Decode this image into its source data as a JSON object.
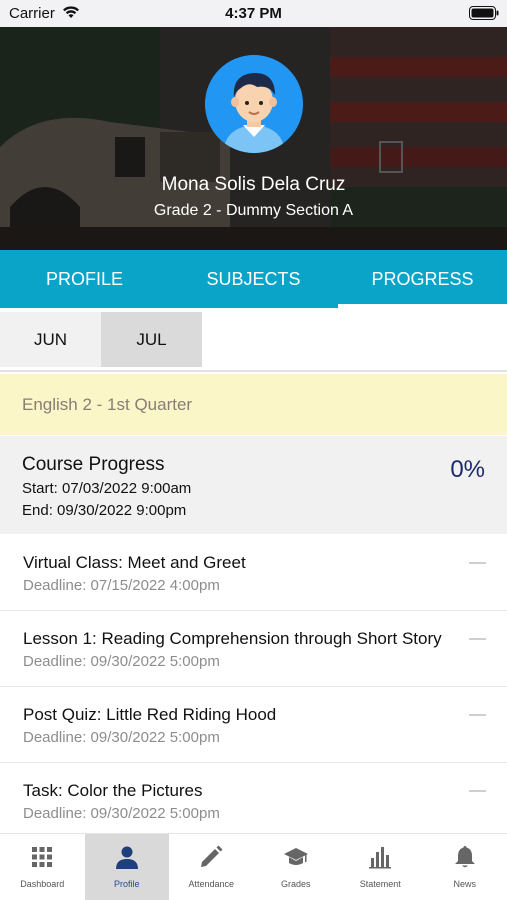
{
  "status_bar": {
    "carrier": "Carrier",
    "time": "4:37 PM"
  },
  "student": {
    "name": "Mona Solis Dela Cruz",
    "grade_section": "Grade 2 - Dummy Section A"
  },
  "tabs": [
    {
      "label": "PROFILE"
    },
    {
      "label": "SUBJECTS"
    },
    {
      "label": "PROGRESS"
    }
  ],
  "active_tab": "PROGRESS",
  "months": [
    {
      "label": "JUN"
    },
    {
      "label": "JUL"
    }
  ],
  "selected_month": "JUL",
  "subject": {
    "title": "English 2 - 1st Quarter"
  },
  "course_progress": {
    "title": "Course Progress",
    "start": "Start: 07/03/2022 9:00am",
    "end": "End: 09/30/2022 9:00pm",
    "percent": "0%"
  },
  "tasks": [
    {
      "title": "Virtual Class: Meet and Greet",
      "deadline": "Deadline: 07/15/2022 4:00pm"
    },
    {
      "title": "Lesson 1: Reading Comprehension through Short Story",
      "deadline": "Deadline: 09/30/2022 5:00pm"
    },
    {
      "title": "Post Quiz: Little Red Riding Hood",
      "deadline": "Deadline: 09/30/2022 5:00pm"
    },
    {
      "title": "Task: Color the Pictures",
      "deadline": "Deadline: 09/30/2022 5:00pm"
    }
  ],
  "bottom_nav": [
    {
      "label": "Dashboard",
      "icon": "grid-icon"
    },
    {
      "label": "Profile",
      "icon": "person-icon"
    },
    {
      "label": "Attendance",
      "icon": "pencil-icon"
    },
    {
      "label": "Grades",
      "icon": "graduation-cap-icon"
    },
    {
      "label": "Statement",
      "icon": "bar-chart-icon"
    },
    {
      "label": "News",
      "icon": "bell-icon"
    }
  ],
  "active_nav": "Profile",
  "colors": {
    "tab_bar": "#0ba4c9",
    "subject_banner": "#fbf6c8",
    "percent_text": "#1c2a6b",
    "avatar_bg": "#2196f3"
  }
}
